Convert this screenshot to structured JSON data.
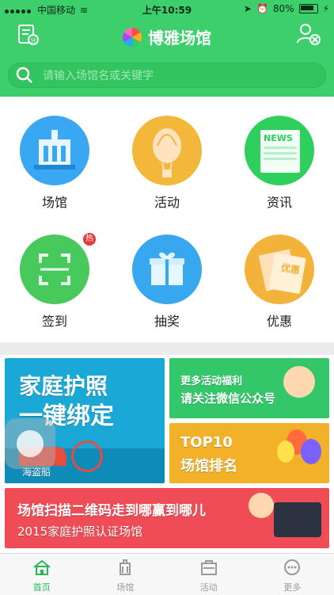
{
  "status_bar": {
    "carrier": "中国移动",
    "time": "上午10:59",
    "battery": "80%"
  },
  "header": {
    "title": "博雅场馆"
  },
  "search": {
    "placeholder": "请输入场馆名或关键字"
  },
  "grid": {
    "items": [
      {
        "label": "场馆",
        "color": "#3aa7f3"
      },
      {
        "label": "活动",
        "color": "#f3b73a"
      },
      {
        "label": "资讯",
        "color": "#2fcf5e"
      },
      {
        "label": "签到",
        "color": "#48c95b",
        "badge": "热"
      },
      {
        "label": "抽奖",
        "color": "#37a8ef"
      },
      {
        "label": "优惠",
        "color": "#f3b33a"
      }
    ],
    "news_label": "NEWS",
    "coupon_label": "优惠"
  },
  "banners": {
    "family": {
      "line1": "家庭护照",
      "line2": "一键绑定",
      "scene": "海盗船"
    },
    "wechat": {
      "line1": "更多活动福利",
      "line2": "请关注微信公众号"
    },
    "top10": {
      "line1": "TOP10",
      "line2": "场馆排名"
    },
    "scan": {
      "line1": "场馆扫描二维码走到哪赢到哪儿",
      "line2": "2015家庭护照认证场馆"
    }
  },
  "tabbar": {
    "tabs": [
      {
        "label": "首页"
      },
      {
        "label": "场馆"
      },
      {
        "label": "活动"
      },
      {
        "label": "更多"
      }
    ]
  }
}
